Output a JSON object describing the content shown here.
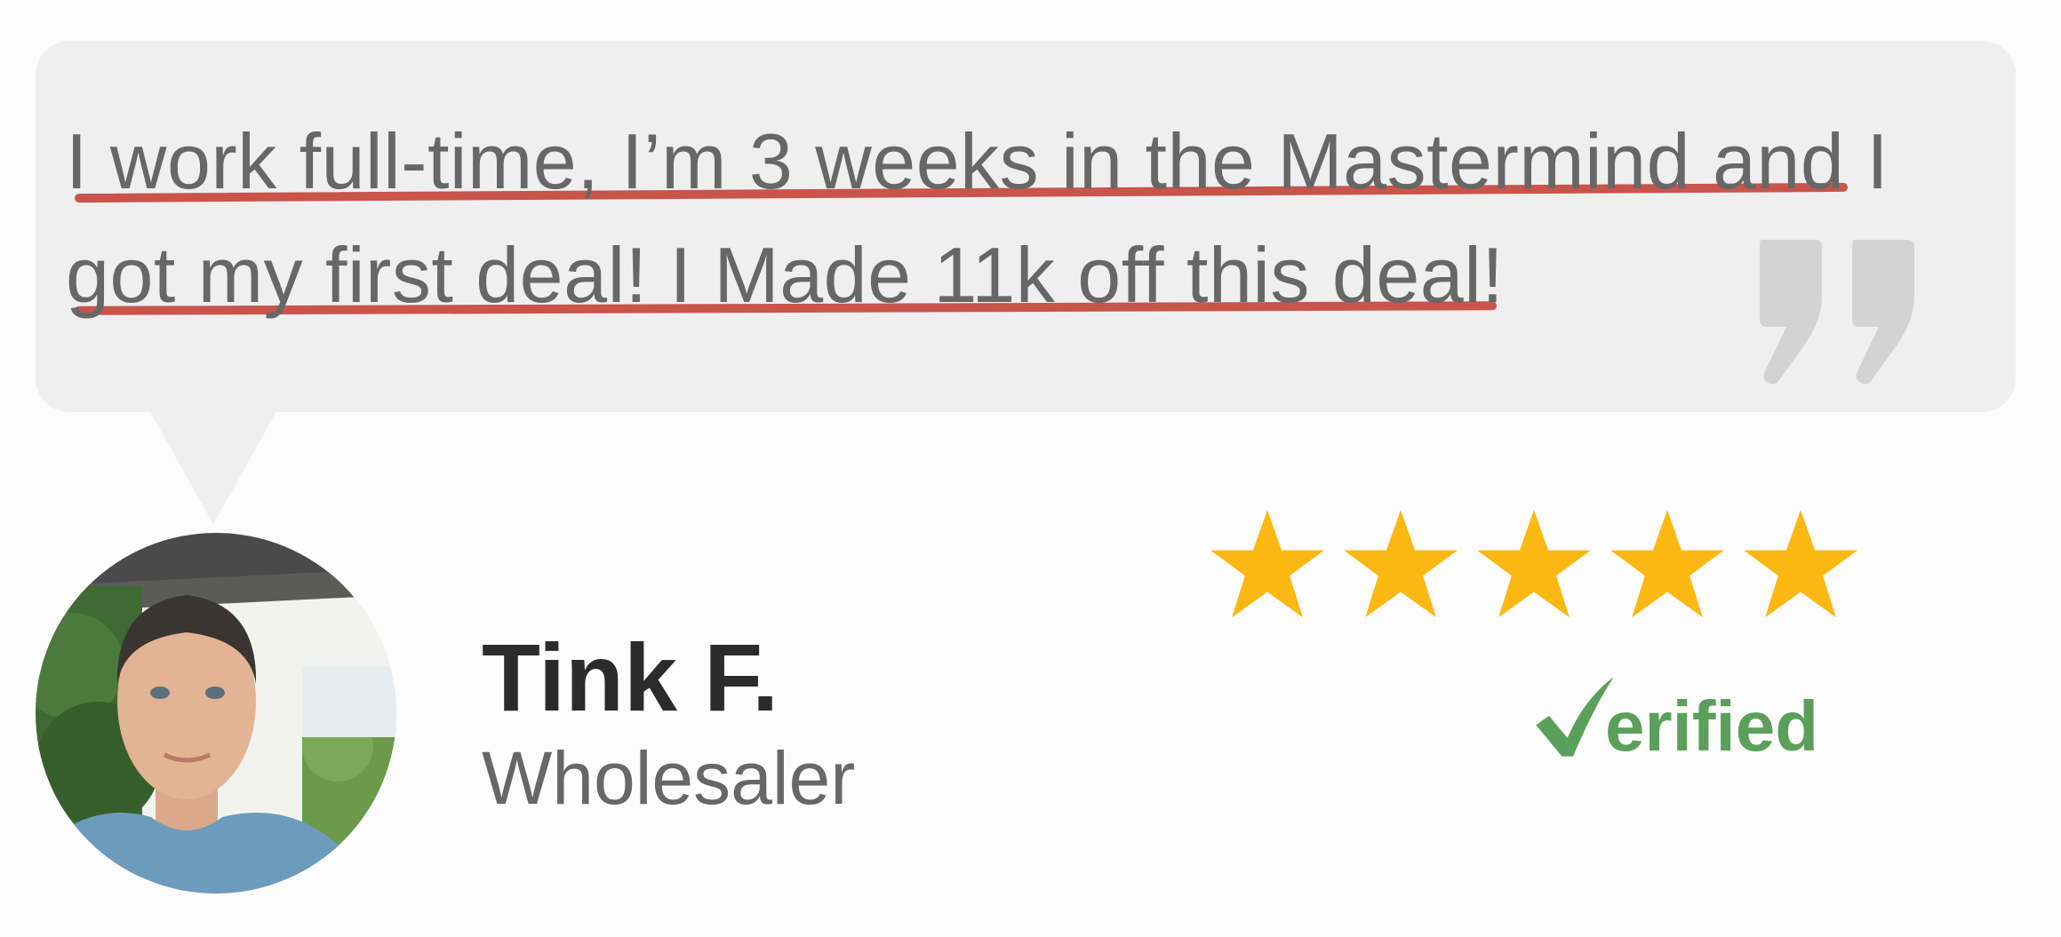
{
  "testimonial": {
    "quote_line1": "I work full-time, I’m 3 weeks in the Mastermind and I",
    "quote_line2": "got my first deal! I Made 11k off this deal!"
  },
  "author": {
    "name": "Tink F.",
    "role": "Wholesaler"
  },
  "rating": {
    "value": 5,
    "max": 5
  },
  "badge": {
    "text": "erified",
    "icon": "checkmark-icon"
  },
  "colors": {
    "bubble": "#efefef",
    "underline": "#c8544a",
    "star": "#fcb812",
    "verified": "#5aa05a",
    "quote_text": "#676767",
    "name": "#2b2b2b"
  }
}
